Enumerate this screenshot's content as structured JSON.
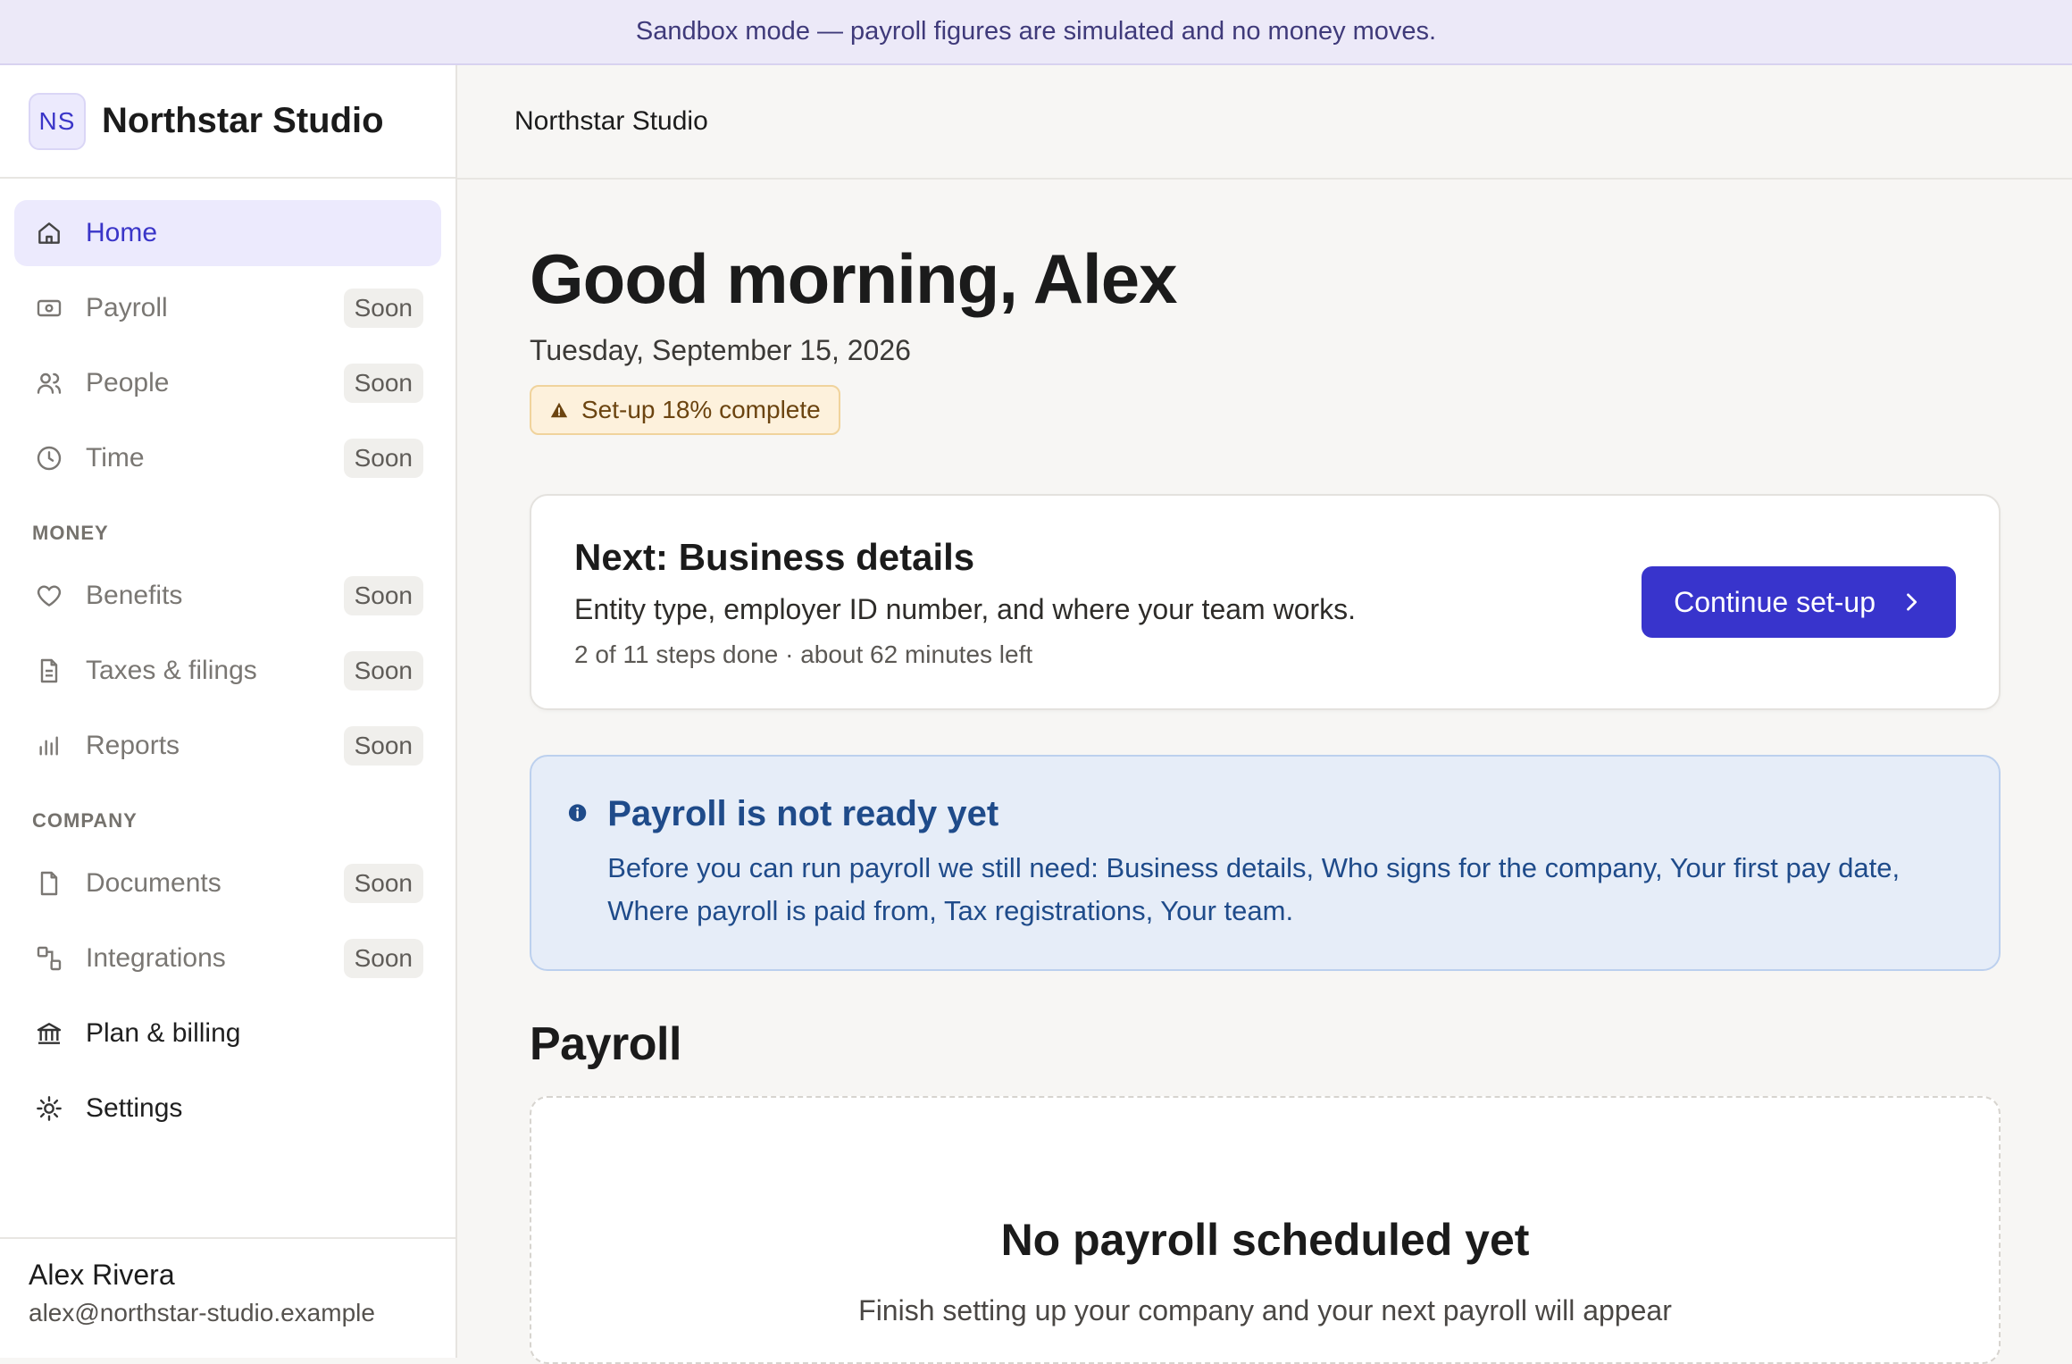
{
  "banner": {
    "text": "Sandbox mode — payroll figures are simulated and no money moves."
  },
  "brand": {
    "logo": "NS",
    "name": "Northstar Studio"
  },
  "nav": {
    "primary": [
      {
        "label": "Home",
        "icon": "home-icon",
        "badge": ""
      },
      {
        "label": "Payroll",
        "icon": "banknote-icon",
        "badge": "Soon"
      },
      {
        "label": "People",
        "icon": "people-icon",
        "badge": "Soon"
      },
      {
        "label": "Time",
        "icon": "clock-icon",
        "badge": "Soon"
      }
    ],
    "money_label": "MONEY",
    "money": [
      {
        "label": "Benefits",
        "icon": "heart-icon",
        "badge": "Soon"
      },
      {
        "label": "Taxes & filings",
        "icon": "document-icon",
        "badge": "Soon"
      },
      {
        "label": "Reports",
        "icon": "bar-chart-icon",
        "badge": "Soon"
      }
    ],
    "company_label": "COMPANY",
    "company": [
      {
        "label": "Documents",
        "icon": "file-icon",
        "badge": "Soon"
      },
      {
        "label": "Integrations",
        "icon": "integrations-icon",
        "badge": "Soon"
      },
      {
        "label": "Plan & billing",
        "icon": "bank-icon",
        "badge": ""
      },
      {
        "label": "Settings",
        "icon": "gear-icon",
        "badge": ""
      }
    ]
  },
  "user": {
    "name": "Alex Rivera",
    "email": "alex@northstar-studio.example"
  },
  "topbar": {
    "title": "Northstar Studio"
  },
  "main": {
    "greeting": "Good morning, Alex",
    "date": "Tuesday, September 15, 2026",
    "setup_badge": "Set-up 18% complete",
    "setup_progress_percent": 18,
    "next_card": {
      "title": "Next: Business details",
      "description": "Entity type, employer ID number, and where your team works.",
      "meta": "2 of 11 steps done · about 62 minutes left",
      "button": "Continue set-up"
    },
    "info": {
      "title": "Payroll is not ready yet",
      "body": "Before you can run payroll we still need: Business details, Who signs for the company, Your first pay date, Where payroll is paid from, Tax registrations, Your team."
    },
    "payroll_section": {
      "title": "Payroll",
      "empty_title": "No payroll scheduled yet",
      "empty_body": "Finish setting up your company and your next payroll will appear"
    }
  },
  "colors": {
    "accent": "#3834cc",
    "info": "#1f4b8a",
    "warning": "#6b4410"
  }
}
